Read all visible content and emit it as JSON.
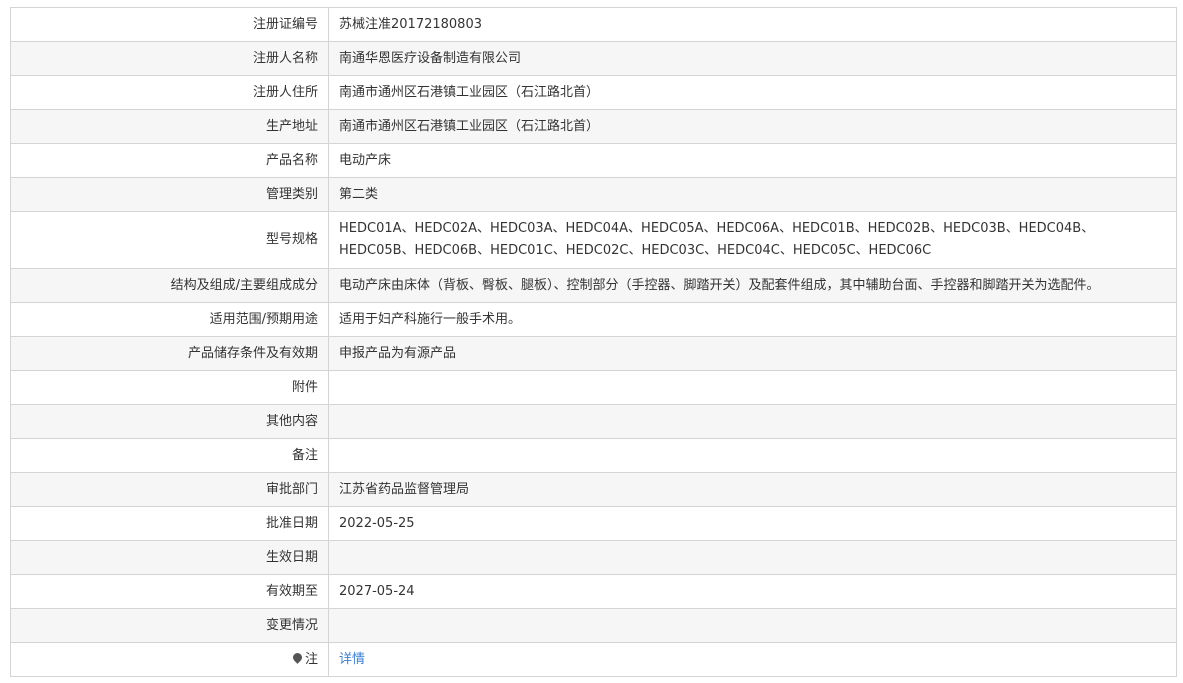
{
  "rows": [
    {
      "label": "注册证编号",
      "value": "苏械注准20172180803"
    },
    {
      "label": "注册人名称",
      "value": "南通华恩医疗设备制造有限公司"
    },
    {
      "label": "注册人住所",
      "value": "南通市通州区石港镇工业园区（石江路北首）"
    },
    {
      "label": "生产地址",
      "value": "南通市通州区石港镇工业园区（石江路北首）"
    },
    {
      "label": "产品名称",
      "value": "电动产床"
    },
    {
      "label": "管理类别",
      "value": "第二类"
    },
    {
      "label": "型号规格",
      "value": "HEDC01A、HEDC02A、HEDC03A、HEDC04A、HEDC05A、HEDC06A、HEDC01B、HEDC02B、HEDC03B、HEDC04B、HEDC05B、HEDC06B、HEDC01C、HEDC02C、HEDC03C、HEDC04C、HEDC05C、HEDC06C"
    },
    {
      "label": "结构及组成/主要组成成分",
      "value": "电动产床由床体（背板、臀板、腿板）、控制部分（手控器、脚踏开关）及配套件组成，其中辅助台面、手控器和脚踏开关为选配件。"
    },
    {
      "label": "适用范围/预期用途",
      "value": "适用于妇产科施行一般手术用。"
    },
    {
      "label": "产品储存条件及有效期",
      "value": "申报产品为有源产品"
    },
    {
      "label": "附件",
      "value": ""
    },
    {
      "label": "其他内容",
      "value": ""
    },
    {
      "label": "备注",
      "value": ""
    },
    {
      "label": "审批部门",
      "value": "江苏省药品监督管理局"
    },
    {
      "label": "批准日期",
      "value": "2022-05-25"
    },
    {
      "label": "生效日期",
      "value": ""
    },
    {
      "label": "有效期至",
      "value": "2027-05-24"
    },
    {
      "label": "变更情况",
      "value": ""
    }
  ],
  "note": {
    "label": "注",
    "link": "详情"
  }
}
